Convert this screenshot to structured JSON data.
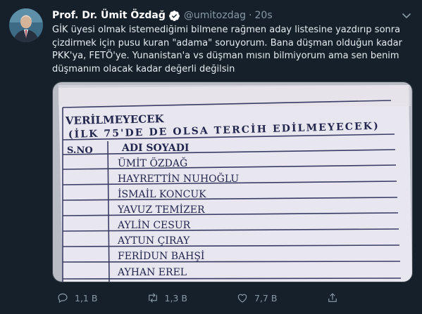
{
  "author": {
    "display_name": "Prof. Dr. Ümit Özdağ",
    "handle": "@umitozdag",
    "separator": "·",
    "timestamp": "20s"
  },
  "tweet": {
    "lines": [
      "GİK üyesi olmak istemediğimi  bilmene rağmen aday listesine yazdırıp sonra",
      "çizdirmek için pusu kuran \"adama\" soruyorum. Bana düşman olduğun kadar",
      "PKK'ya, FETÖ'ye. Yunanistan'a vs düşman mısın bilmiyorum ama sen benim",
      "düşmanım olacak kadar değerli değilsin"
    ]
  },
  "photo": {
    "heading1": "VERİLMEYECEK",
    "heading2": "(İLK 75'DE DE OLSA TERCİH EDİLMEYECEK)",
    "col_no": "S.NO",
    "col_name": "ADI SOYADI",
    "names": [
      "ÜMİT ÖZDAĞ",
      "HAYRETTİN NUHOĞLU",
      "İSMAİL KONCUK",
      "YAVUZ TEMİZER",
      "AYLİN CESUR",
      "AYTUN ÇIRAY",
      "FERİDUN BAHŞİ",
      "AYHAN EREL"
    ]
  },
  "actions": {
    "reply_count": "1,1 B",
    "retweet_count": "1,3 B",
    "like_count": "7,7 B"
  },
  "colors": {
    "background": "#15202b",
    "secondary_text": "#8899a6",
    "verified_blue": "#1da1f2"
  }
}
